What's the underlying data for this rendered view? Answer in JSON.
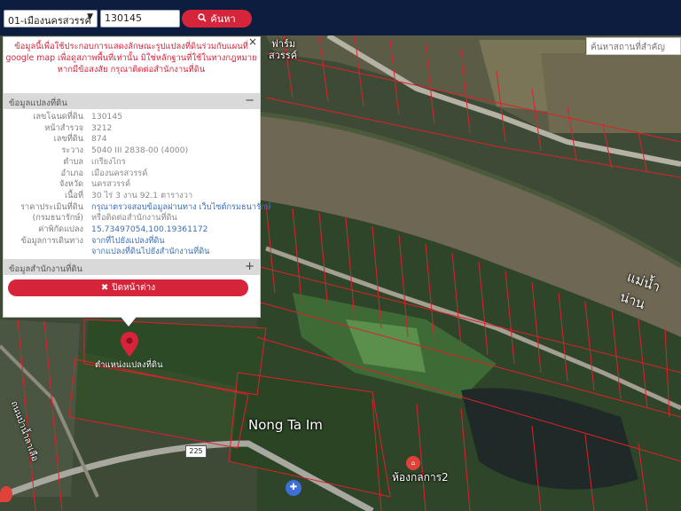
{
  "search": {
    "province_value": "01-เมืองนครสวรรค์",
    "deed_value": "130145",
    "button_label": "ค้นหา",
    "place_placeholder": "ค้นหาสถานที่สำคัญ"
  },
  "panel": {
    "disclaimer": "ข้อมูลนี้เพื่อใช้ประกอบการแสดงลักษณะรูปแปลงที่ดินร่วมกับแผนที่ google map เพื่อดูสภาพพื้นที่เท่านั้น มิใช่หลักฐานที่ใช้ในทางกฎหมาย หากมีข้อสงสัย กรุณาติดต่อสำนักงานที่ดิน",
    "land_section_title": "ข้อมูลแปลงที่ดิน",
    "land_section_toggle": "−",
    "office_section_title": "ข้อมูลสำนักงานที่ดิน",
    "office_section_toggle": "+",
    "close_info_label": "ปิดหน้าต่าง",
    "close_label": "×",
    "rows": [
      {
        "label": "เลขโฉนดที่ดิน",
        "value": "130145"
      },
      {
        "label": "หน้าสำรวจ",
        "value": "3212"
      },
      {
        "label": "เลขที่ดิน",
        "value": "874"
      },
      {
        "label": "ระวาง",
        "value": "5040 III 2838-00 (4000)"
      },
      {
        "label": "ตำบล",
        "value": "เกรียงไกร"
      },
      {
        "label": "อำเภอ",
        "value": "เมืองนครสวรรค์"
      },
      {
        "label": "จังหวัด",
        "value": "นครสวรรค์"
      },
      {
        "label": "เนื้อที่",
        "value": "30 ไร่ 3 งาน 92.1 ตารางวา"
      },
      {
        "label": "ราคาประเมินที่ดิน",
        "value": "กรุณาตรวจสอบข้อมูลผ่านทาง เว็บไซต์กรมธนารักษ์"
      },
      {
        "label": "(กรมธนารักษ์)",
        "value": "หรือติดต่อสำนักงานที่ดิน"
      },
      {
        "label": "ค่าพิกัดแปลง",
        "value": "15.73497054,100.19361172"
      },
      {
        "label": "ข้อมูลการเดินทาง",
        "value": "จากที่ไปยังแปลงที่ดิน"
      },
      {
        "label": "",
        "value": "จากแปลงที่ดินไปยังสำนักงานที่ดิน"
      }
    ]
  },
  "map": {
    "pin_label": "ตำแหน่งแปลงที่ดิน",
    "area_label": "Nong Ta Im",
    "river_label": "แม่น้ำน่าน",
    "road_label": "ถนนป่าน้ำลาเลือ",
    "place_label_1": "ฟาร์ม",
    "place_label_2": "สวรรค์",
    "poi_label": "ห้องกลการ2",
    "route_number": "225",
    "colors": {
      "topbar": "#0c1d3f",
      "accent": "#d6243a",
      "parcel_line": "#e0202a"
    }
  }
}
